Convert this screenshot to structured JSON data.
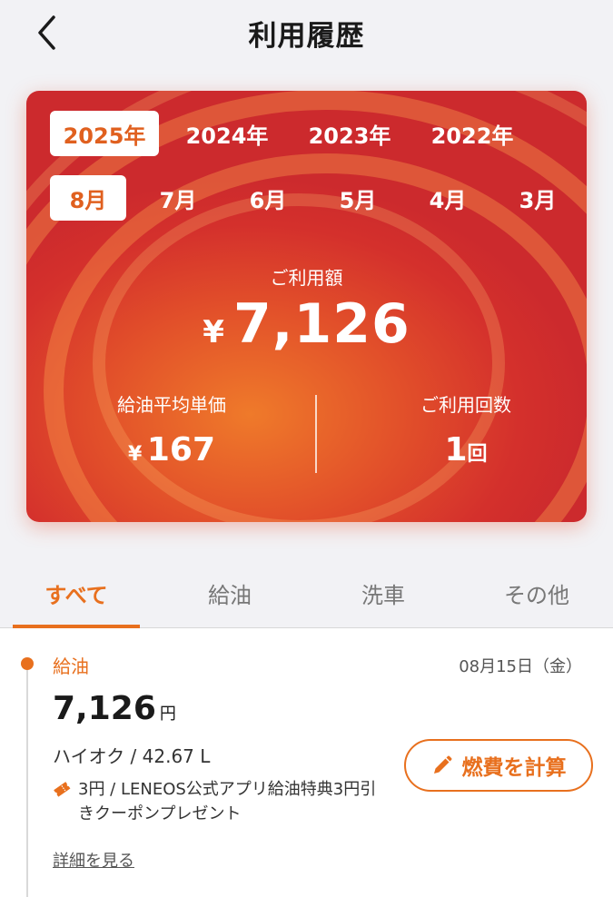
{
  "header": {
    "title": "利用履歴",
    "back_icon": "chevron-left-icon"
  },
  "card": {
    "years": [
      "2025年",
      "2024年",
      "2023年",
      "2022年"
    ],
    "selected_year": "2025年",
    "months": [
      "8月",
      "7月",
      "6月",
      "5月",
      "4月",
      "3月"
    ],
    "selected_month": "8月",
    "usage_label": "ご利用額",
    "usage_yen": "¥",
    "usage_amount": "7,126",
    "avg_price_label": "給油平均単価",
    "avg_price_yen": "¥",
    "avg_price_value": "167",
    "count_label": "ご利用回数",
    "count_value": "1",
    "count_unit": "回"
  },
  "tabs": [
    "すべて",
    "給油",
    "洗車",
    "その他"
  ],
  "active_tab": "すべて",
  "history": [
    {
      "category": "給油",
      "date": "08月15日（金）",
      "amount": "7,126",
      "unit": "円",
      "fuel": "ハイオク / 42.67 L",
      "coupon": "3円 / LENEOS公式アプリ給油特典3円引きクーポンプレゼント",
      "coupon_icon": "ticket-icon",
      "detail_link": "詳細を見る",
      "calc_button": "燃費を計算",
      "calc_icon": "pencil-icon"
    }
  ],
  "colors": {
    "accent": "#e8701e",
    "card_red": "#d4302c",
    "card_orange": "#ef7a2a"
  }
}
